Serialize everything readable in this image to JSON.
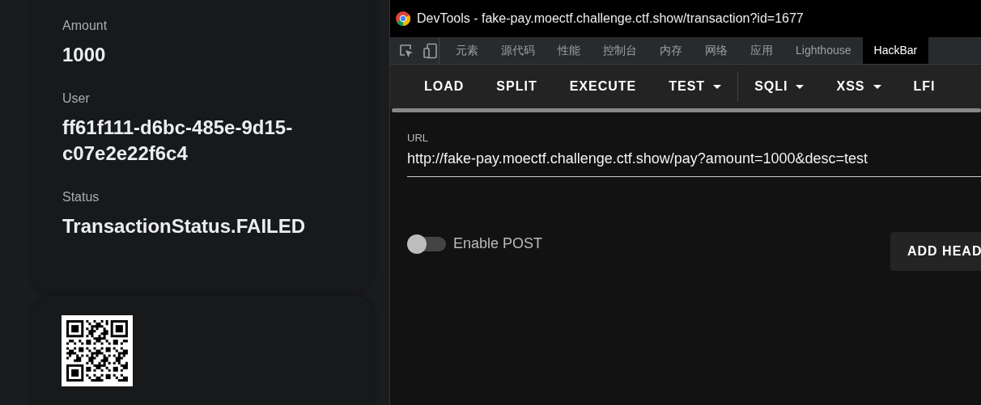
{
  "transaction": {
    "fields": [
      {
        "label": "Amount",
        "value": "1000"
      },
      {
        "label": "User",
        "value": "ff61f111-d6bc-485e-9d15-c07e2e22f6c4"
      },
      {
        "label": "Status",
        "value": "TransactionStatus.FAILED"
      }
    ]
  },
  "devtools": {
    "title": "DevTools - fake-pay.moectf.challenge.ctf.show/transaction?id=1677",
    "tabs": [
      {
        "label": "元素",
        "selected": false
      },
      {
        "label": "源代码",
        "selected": false
      },
      {
        "label": "性能",
        "selected": false
      },
      {
        "label": "控制台",
        "selected": false
      },
      {
        "label": "内存",
        "selected": false
      },
      {
        "label": "网络",
        "selected": false
      },
      {
        "label": "应用",
        "selected": false
      },
      {
        "label": "Lighthouse",
        "selected": false
      },
      {
        "label": "HackBar",
        "selected": true
      }
    ],
    "hackbar": {
      "toolbar": [
        {
          "label": "LOAD",
          "dropdown": false
        },
        {
          "label": "SPLIT",
          "dropdown": false
        },
        {
          "label": "EXECUTE",
          "dropdown": false
        },
        {
          "label": "TEST",
          "dropdown": true
        },
        {
          "label": "SQLI",
          "dropdown": true
        },
        {
          "label": "XSS",
          "dropdown": true
        },
        {
          "label": "LFI",
          "dropdown": false
        }
      ],
      "url": {
        "label": "URL",
        "value": "http://fake-pay.moectf.challenge.ctf.show/pay?amount=1000&desc=test"
      },
      "enable_post": {
        "label": "Enable POST",
        "on": false
      },
      "add_header_button": "ADD HEAD"
    }
  }
}
